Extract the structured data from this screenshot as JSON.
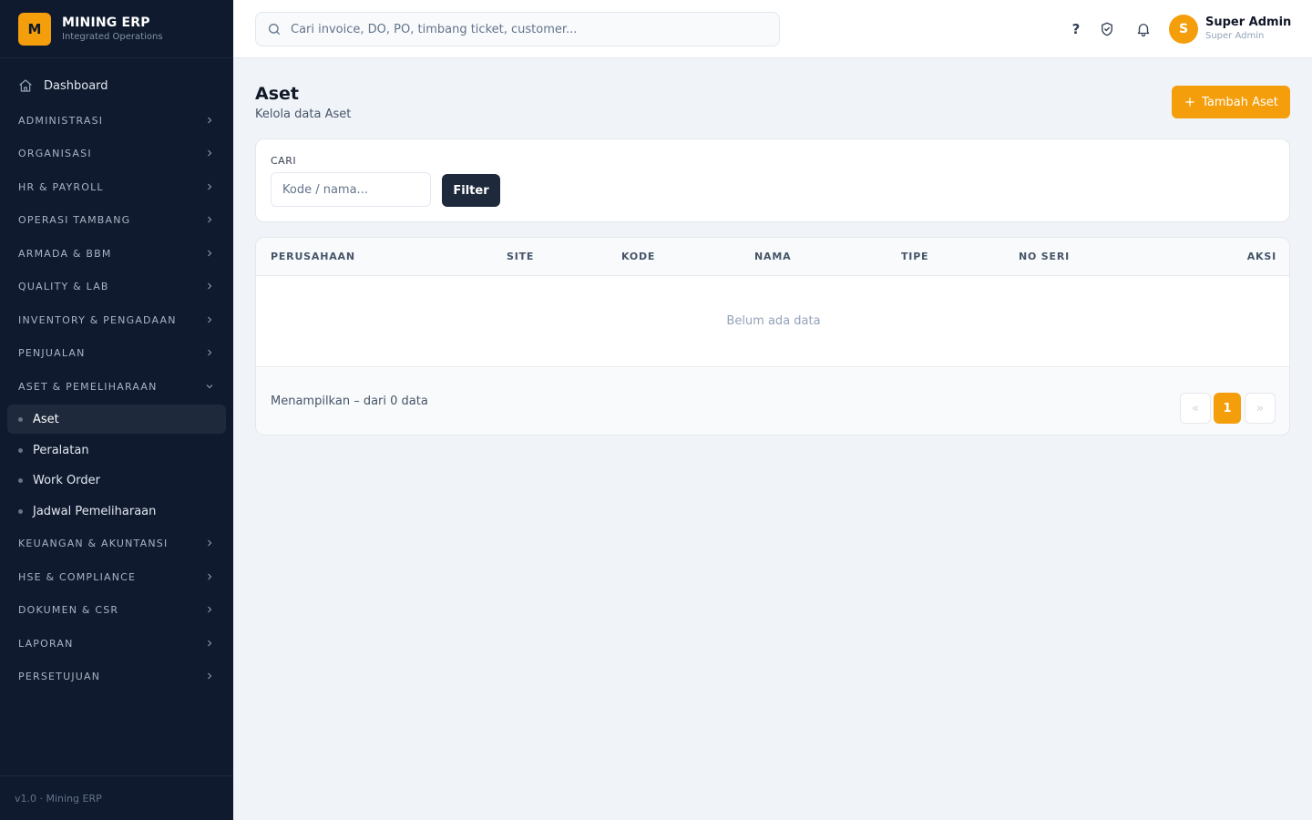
{
  "brand": {
    "logo_letter": "M",
    "title": "MINING ERP",
    "subtitle": "Integrated Operations"
  },
  "sidebar": {
    "dashboard_label": "Dashboard",
    "sections": [
      {
        "label": "ADMINISTRASI",
        "expanded": false
      },
      {
        "label": "ORGANISASI",
        "expanded": false
      },
      {
        "label": "HR & PAYROLL",
        "expanded": false
      },
      {
        "label": "OPERASI TAMBANG",
        "expanded": false
      },
      {
        "label": "ARMADA & BBM",
        "expanded": false
      },
      {
        "label": "QUALITY & LAB",
        "expanded": false
      },
      {
        "label": "INVENTORY & PENGADAAN",
        "expanded": false
      },
      {
        "label": "PENJUALAN",
        "expanded": false
      },
      {
        "label": "ASET & PEMELIHARAAN",
        "expanded": true
      },
      {
        "label": "KEUANGAN & AKUNTANSI",
        "expanded": false
      },
      {
        "label": "HSE & COMPLIANCE",
        "expanded": false
      },
      {
        "label": "DOKUMEN & CSR",
        "expanded": false
      },
      {
        "label": "LAPORAN",
        "expanded": false
      },
      {
        "label": "PERSETUJUAN",
        "expanded": false
      }
    ],
    "subitems": [
      {
        "label": "Aset",
        "active": true
      },
      {
        "label": "Peralatan",
        "active": false
      },
      {
        "label": "Work Order",
        "active": false
      },
      {
        "label": "Jadwal Pemeliharaan",
        "active": false
      }
    ],
    "version": "v1.0 · Mining ERP"
  },
  "topbar": {
    "search_placeholder": "Cari invoice, DO, PO, timbang ticket, customer...",
    "help_label": "?",
    "user_initial": "S",
    "user_name": "Super Admin",
    "user_role": "Super Admin"
  },
  "page": {
    "title": "Aset",
    "subtitle": "Kelola data Aset",
    "add_button": "Tambah Aset"
  },
  "filter": {
    "label": "CARI",
    "placeholder": "Kode / nama...",
    "button": "Filter"
  },
  "table": {
    "columns": [
      "PERUSAHAAN",
      "SITE",
      "KODE",
      "NAMA",
      "TIPE",
      "NO SERI",
      "AKSI"
    ],
    "rows": [],
    "empty_text": "Belum ada data",
    "showing_text": "Menampilkan – dari 0 data",
    "pagination": {
      "prev": "«",
      "current": "1",
      "next": "»"
    }
  },
  "colors": {
    "accent": "#f59e0b",
    "sidebar_bg": "#0f1a2e",
    "dark_button": "#1e293b"
  },
  "icons": [
    "home-icon",
    "chevron-right-icon",
    "chevron-down-icon",
    "search-icon",
    "help-icon",
    "shield-check-icon",
    "bell-icon",
    "plus-icon"
  ]
}
